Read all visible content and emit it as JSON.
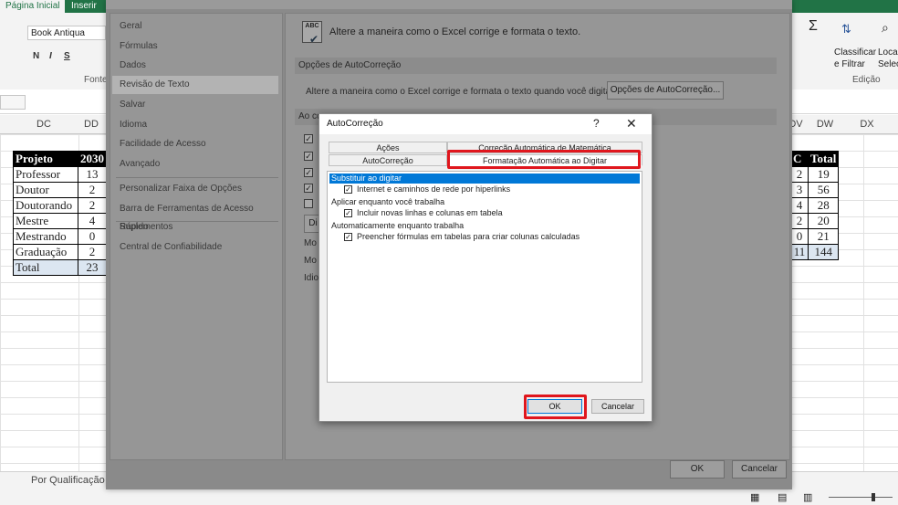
{
  "ribbon": {
    "tabs": [
      "Página Inicial",
      "Inserir"
    ],
    "font_name": "Book Antiqua",
    "format_buttons": [
      "N",
      "I",
      "S"
    ],
    "font_group_label": "Fonte",
    "sort_label_1": "Classificar",
    "sort_label_2": "e Filtrar",
    "find_label_1": "Loca",
    "find_label_2": "Selec",
    "editing_group_label": "Edição"
  },
  "columns": [
    "DC",
    "DD",
    "DV",
    "DW",
    "DX"
  ],
  "left_table": {
    "header": [
      "Projeto",
      "2030"
    ],
    "rows": [
      [
        "Professor",
        "13"
      ],
      [
        "Doutor",
        "2"
      ],
      [
        "Doutorando",
        "2"
      ],
      [
        "Mestre",
        "4"
      ],
      [
        "Mestrando",
        "0"
      ],
      [
        "Graduação",
        "2"
      ]
    ],
    "total": [
      "Total",
      "23"
    ]
  },
  "right_table": {
    "header": [
      "C",
      "Total"
    ],
    "rows": [
      [
        "2",
        "19"
      ],
      [
        "3",
        "56"
      ],
      [
        "4",
        "28"
      ],
      [
        "2",
        "20"
      ],
      [
        "0",
        "21"
      ]
    ],
    "total": [
      "11",
      "144"
    ]
  },
  "status": {
    "sheet_tab": "Por Qualificação"
  },
  "options": {
    "nav": [
      "Geral",
      "Fórmulas",
      "Dados",
      "Revisão de Texto",
      "Salvar",
      "Idioma",
      "Facilidade de Acesso",
      "Avançado",
      "Personalizar Faixa de Opções",
      "Barra de Ferramentas de Acesso Rápido",
      "Suplementos",
      "Central de Confiabilidade"
    ],
    "active_nav": "Revisão de Texto",
    "description": "Altere a maneira como o Excel corrige e formata o texto.",
    "section_autocorrect": "Opções de AutoCorreção",
    "autocorrect_line": "Altere a maneira como o Excel corrige e formata o texto quando você digita:",
    "autocorrect_button": "Opções de AutoCorreção...",
    "section_spelling": "Ao co",
    "dic_button": "Di",
    "mode_label_1": "Mo",
    "mode_label_2": "Mo",
    "lang_label": "Idio",
    "ok": "OK",
    "cancel": "Cancelar"
  },
  "dialog": {
    "title": "AutoCorreção",
    "help": "?",
    "close": "✕",
    "tabs": {
      "acoes": "Ações",
      "math": "Correção Automática de Matemática",
      "autocorrecao": "AutoCorreção",
      "format": "Formatação Automática ao Digitar"
    },
    "group_replace": "Substituir ao digitar",
    "opt_hyperlinks": "Internet e caminhos de rede por hiperlinks",
    "group_apply": "Aplicar enquanto você trabalha",
    "opt_rows_cols": "Incluir novas linhas e colunas em tabela",
    "group_auto": "Automaticamente enquanto trabalha",
    "opt_formulas": "Preencher fórmulas em tabelas  para criar colunas calculadas",
    "ok": "OK",
    "cancel": "Cancelar"
  },
  "colors": {
    "excel_green": "#217346",
    "highlight_red": "#e0161d",
    "selection_blue": "#0078d7"
  }
}
